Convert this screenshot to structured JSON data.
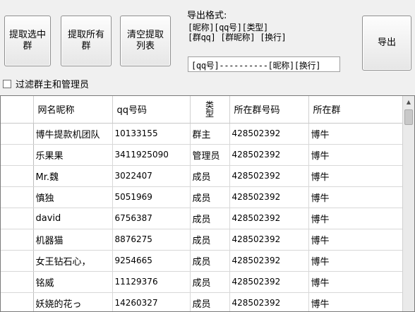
{
  "buttons": {
    "extract_selected": "提取选中群",
    "extract_all": "提取所有群",
    "clear_list": "清空提取列表",
    "export": "导出"
  },
  "export_format": {
    "label": "导出格式:",
    "line1": "[昵称][qq号][类型]",
    "line2": "[群qq] [群昵称] [换行]",
    "value": "[qq号]----------[昵称][换行]"
  },
  "filter": {
    "label": "过滤群主和管理员",
    "checked": false
  },
  "table": {
    "columns": [
      "网名昵称",
      "qq号码",
      "类型",
      "所在群号码",
      "所在群"
    ],
    "rows": [
      [
        "博牛提款机团队",
        "10133155",
        "群主",
        "428502392",
        "博牛"
      ],
      [
        "乐果果",
        "3411925090",
        "管理员",
        "428502392",
        "博牛"
      ],
      [
        "Mr.魏",
        "3022407",
        "成员",
        "428502392",
        "博牛"
      ],
      [
        "慎独",
        "5051969",
        "成员",
        "428502392",
        "博牛"
      ],
      [
        "david",
        "6756387",
        "成员",
        "428502392",
        "博牛"
      ],
      [
        "机器猫",
        "8876275",
        "成员",
        "428502392",
        "博牛"
      ],
      [
        "女王钻石心，",
        "9254665",
        "成员",
        "428502392",
        "博牛"
      ],
      [
        "铭威",
        "11129376",
        "成员",
        "428502392",
        "博牛"
      ],
      [
        "妖娆的花っ",
        "14260327",
        "成员",
        "428502392",
        "博牛"
      ]
    ]
  },
  "icons": {
    "scroll_up": "triangle-up"
  }
}
